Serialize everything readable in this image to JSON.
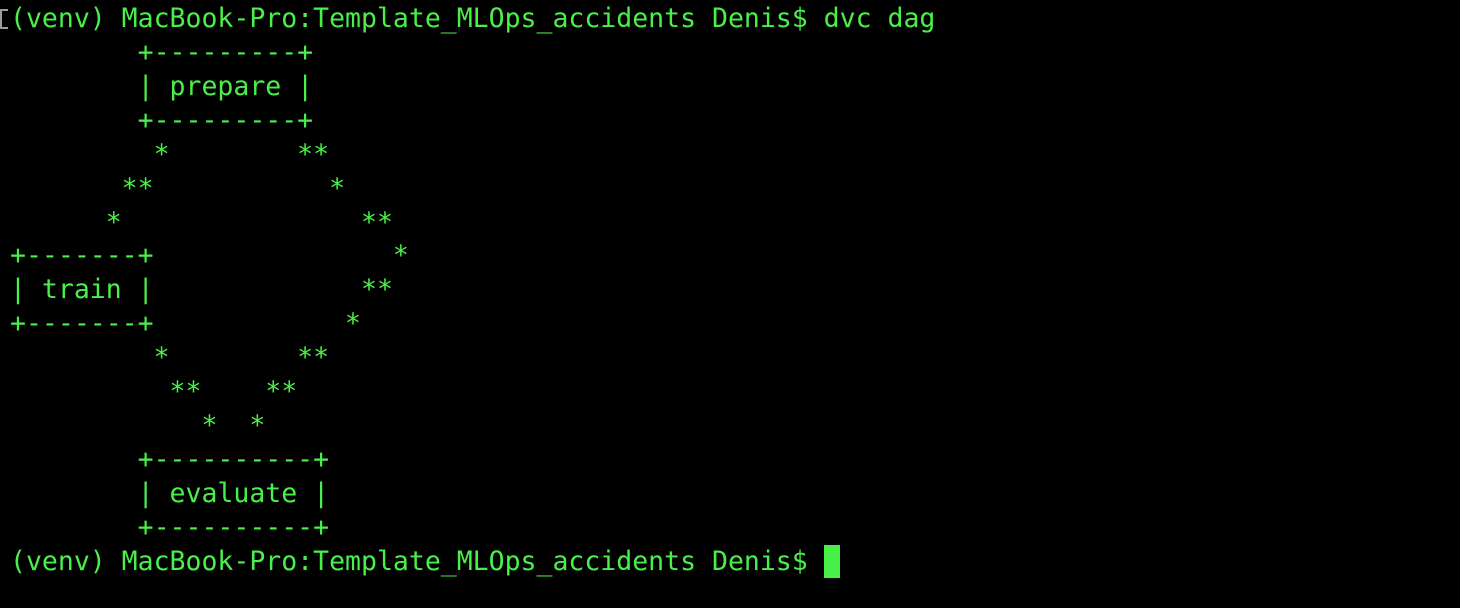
{
  "terminal": {
    "lines": [
      "(venv) MacBook-Pro:Template_MLOps_accidents Denis$ dvc dag",
      "        +---------+",
      "        | prepare |",
      "        +---------+",
      "         *        **",
      "       **           *",
      "      *               **",
      "+-------+               *",
      "| train |             **",
      "+-------+            *",
      "         *        **",
      "          **    **",
      "            *  *",
      "        +----------+",
      "        | evaluate |",
      "        +----------+",
      "(venv) MacBook-Pro:Template_MLOps_accidents Denis$ "
    ],
    "colors": {
      "background": "#000000",
      "foreground": "#4af04a"
    }
  }
}
